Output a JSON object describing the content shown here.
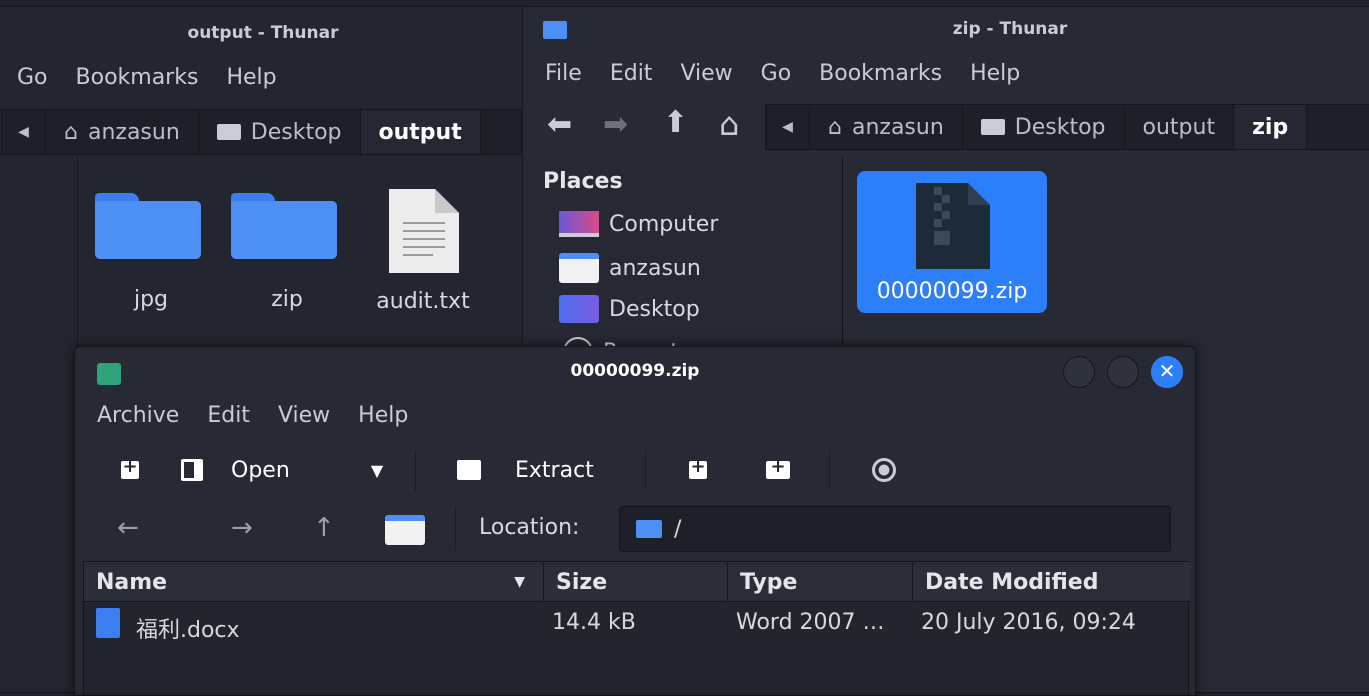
{
  "thunar_output": {
    "title": "output - Thunar",
    "menu": [
      "Go",
      "Bookmarks",
      "Help"
    ],
    "path": [
      "anzasun",
      "Desktop",
      "output"
    ],
    "files": [
      {
        "name": "jpg",
        "icon": "folder-icon"
      },
      {
        "name": "zip",
        "icon": "folder-icon"
      },
      {
        "name": "audit.txt",
        "icon": "text-file-icon"
      }
    ]
  },
  "thunar_zip": {
    "title": "zip - Thunar",
    "menu": [
      "File",
      "Edit",
      "View",
      "Go",
      "Bookmarks",
      "Help"
    ],
    "path": [
      "anzasun",
      "Desktop",
      "output",
      "zip"
    ],
    "sidebar_heading": "Places",
    "places": [
      {
        "label": "Computer",
        "icon": "computer-icon"
      },
      {
        "label": "anzasun",
        "icon": "home-folder-icon"
      },
      {
        "label": "Desktop",
        "icon": "desktop-icon"
      },
      {
        "label": "Recent",
        "icon": "recent-icon"
      }
    ],
    "selected_file": "00000099.zip"
  },
  "archive_manager": {
    "title": "00000099.zip",
    "menu": [
      "Archive",
      "Edit",
      "View",
      "Help"
    ],
    "toolbar": {
      "open_label": "Open",
      "extract_label": "Extract"
    },
    "location_label": "Location:",
    "location_value": "/",
    "columns": [
      "Name",
      "Size",
      "Type",
      "Date Modified"
    ],
    "rows": [
      {
        "name": "福利.docx",
        "size": "14.4 kB",
        "type": "Word 2007 …",
        "modified": "20 July 2016, 09:24"
      }
    ]
  },
  "colors": {
    "accent": "#2d7ff9",
    "folder": "#4d8ff5",
    "window_bg": "#272a34",
    "titlebar_text": "#c8ccd4"
  }
}
